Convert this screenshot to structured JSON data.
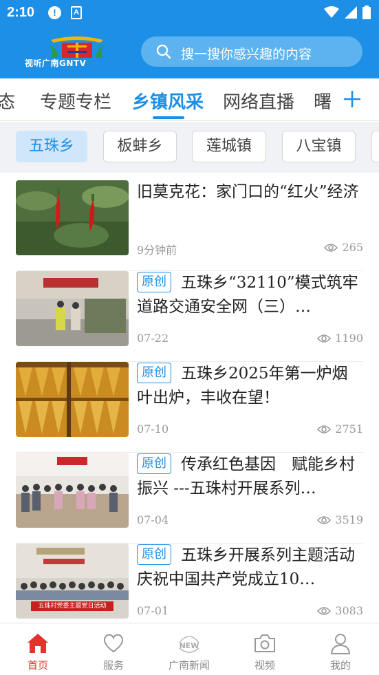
{
  "status_bar": {
    "time": "2:10",
    "alert_glyph": "!",
    "a_glyph": "A"
  },
  "header": {
    "logo_text": "视听广南GNTV",
    "search_placeholder": "搜一搜你感兴趣的内容"
  },
  "channels": [
    {
      "label": "态",
      "active": false
    },
    {
      "label": "专题专栏",
      "active": false
    },
    {
      "label": "乡镇风采",
      "active": true
    },
    {
      "label": "网络直播",
      "active": false
    },
    {
      "label": "曙",
      "active": false
    }
  ],
  "subtabs": [
    {
      "label": "五珠乡",
      "active": true
    },
    {
      "label": "板蚌乡",
      "active": false
    },
    {
      "label": "莲城镇",
      "active": false
    },
    {
      "label": "八宝镇",
      "active": false
    }
  ],
  "news": [
    {
      "tag": "",
      "title": "旧莫克花：家门口的“红火”经济",
      "time": "9分钟前",
      "views": "265",
      "thumb": "chili-icon"
    },
    {
      "tag": "原创",
      "title": "五珠乡“32110”模式筑牢道路交通安全网（三）…",
      "time": "07-22",
      "views": "1190",
      "thumb": "traffic-scene"
    },
    {
      "tag": "原创",
      "title": "五珠乡2025年第一炉烟叶出炉，丰收在望！",
      "time": "07-10",
      "views": "2751",
      "thumb": "tobacco-leaves"
    },
    {
      "tag": "原创",
      "title": "传承红色基因　赋能乡村振兴 ---五珠村开展系列…",
      "time": "07-04",
      "views": "3519",
      "thumb": "meeting-hall"
    },
    {
      "tag": "原创",
      "title": "五珠乡开展系列主题活动　庆祝中国共产党成立10…",
      "time": "07-01",
      "views": "3083",
      "thumb": "group-photo",
      "banner": "五珠村党委主题党日活动"
    }
  ],
  "bottom_nav": [
    {
      "label": "首页",
      "icon": "home-icon",
      "active": true
    },
    {
      "label": "服务",
      "icon": "heart-icon",
      "active": false
    },
    {
      "label": "广南新闻",
      "icon": "news-icon",
      "badge": "NEW",
      "active": false
    },
    {
      "label": "视频",
      "icon": "camera-icon",
      "active": false
    },
    {
      "label": "我的",
      "icon": "user-icon",
      "active": false
    }
  ],
  "colors": {
    "primary": "#1d8fe6",
    "active_nav": "#e5322d",
    "muted": "#999999"
  }
}
